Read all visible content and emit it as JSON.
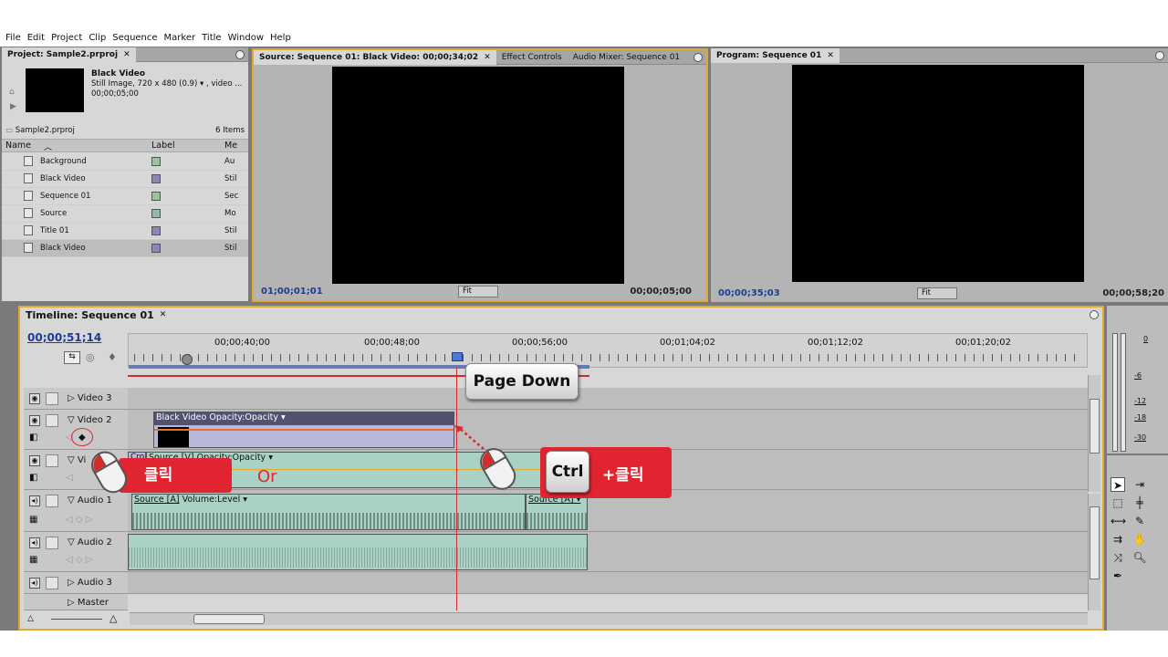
{
  "menu": [
    "File",
    "Edit",
    "Project",
    "Clip",
    "Sequence",
    "Marker",
    "Title",
    "Window",
    "Help"
  ],
  "project": {
    "tab": "Project: Sample2.prproj",
    "selected_name": "Black Video",
    "selected_meta1": "Still Image, 720 x 480 (0.9)  ▾  , video ...",
    "selected_meta2": "00;00;05;00",
    "file": "Sample2.prproj",
    "count": "6 Items",
    "columns": {
      "name": "Name",
      "label": "Label",
      "media": "Me"
    },
    "items": [
      {
        "name": "Background",
        "media": "Au",
        "color": "#9ac49a"
      },
      {
        "name": "Black Video",
        "media": "Stil",
        "color": "#8d86b8"
      },
      {
        "name": "Sequence 01",
        "media": "Sec",
        "color": "#9ac49a"
      },
      {
        "name": "Source",
        "media": "Mo",
        "color": "#8fb8b0"
      },
      {
        "name": "Title 01",
        "media": "Stil",
        "color": "#8d86b8"
      },
      {
        "name": "Black Video",
        "media": "Stil",
        "color": "#8d86b8"
      }
    ]
  },
  "source": {
    "tabs": [
      "Source: Sequence 01: Black Video: 00;00;34;02",
      "Effect Controls",
      "Audio Mixer: Sequence 01"
    ],
    "tc_in": "01;00;01;01",
    "fit": "Fit",
    "tc_dur": "00;00;05;00"
  },
  "program": {
    "tab": "Program: Sequence 01",
    "tc_in": "00;00;35;03",
    "fit": "Fit",
    "tc_dur": "00;00;58;20"
  },
  "timeline": {
    "tab": "Timeline: Sequence 01",
    "current_tc": "00;00;51;14",
    "ruler_labels": [
      "00;00;40;00",
      "00;00;48;00",
      "00;00;56;00",
      "00;01;04;02",
      "00;01;12;02",
      "00;01;20;02"
    ],
    "tracks": {
      "v3": "Video 3",
      "v2": "Video 2",
      "v1": "Vi",
      "a1": "Audio 1",
      "a2": "Audio 2",
      "a3": "Audio 3",
      "master": "Master"
    },
    "clips": {
      "v2_clip": "Black Video",
      "v2_effect": "Opacity:Opacity ▾",
      "v1_prefix": "Cro",
      "v1_clip": "Source [V]",
      "v1_effect": "Opacity:Opacity ▾",
      "a1_clip": "Source [A]",
      "a1_effect": "Volume:Level ▾",
      "a1_clip2": "Source [A] ▾"
    }
  },
  "meters": {
    "labels": [
      "0",
      "-6",
      "-12",
      "-18",
      "-30"
    ]
  },
  "callouts": {
    "page_down": "Page Down",
    "click": "클릭",
    "or": "Or",
    "ctrl": "Ctrl",
    "ctrl_click": "+클릭"
  },
  "colors": {
    "accent": "#e3a830",
    "timecode": "#1b3d96",
    "callout": "#e12530",
    "playhead": "#d32c2c"
  }
}
